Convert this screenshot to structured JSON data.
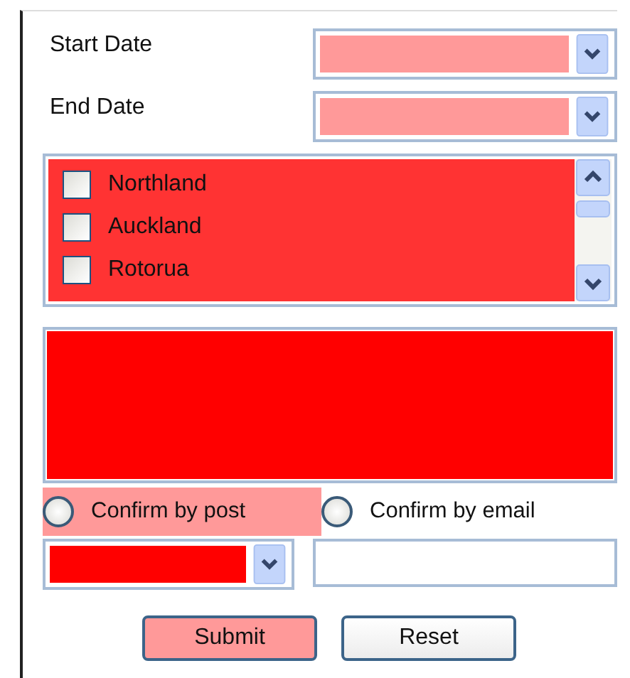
{
  "date_fields": [
    {
      "label": "Start Date",
      "color": "#ff9999"
    },
    {
      "label": "End Date",
      "color": "#ff9999"
    }
  ],
  "region_list": {
    "color": "#ff3333",
    "items": [
      {
        "label": "Northland",
        "checked": false
      },
      {
        "label": "Auckland",
        "checked": false
      },
      {
        "label": "Rotorua",
        "checked": false
      }
    ]
  },
  "text_area": {
    "color": "#ff0000"
  },
  "confirm_options": [
    {
      "label": "Confirm by post",
      "selected": false,
      "color": "#ff9999"
    },
    {
      "label": "Confirm by email",
      "selected": false
    }
  ],
  "option_dropdown": {
    "color": "#ff0000"
  },
  "buttons": [
    {
      "label": "Submit",
      "color": "#ff9999"
    },
    {
      "label": "Reset"
    }
  ]
}
